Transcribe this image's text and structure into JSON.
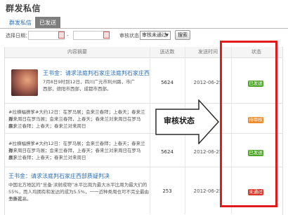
{
  "page": {
    "title": "群发私信"
  },
  "tabs": [
    {
      "label": "群发私信",
      "active": false
    },
    {
      "label": "已发送",
      "active": true
    }
  ],
  "filters": {
    "date_label": "选择日期：",
    "date_from": "",
    "date_to": "",
    "status_label": "审核状态：",
    "status_value": "审核未通过",
    "search_label": "搜索"
  },
  "table": {
    "columns": [
      "内容摘要",
      "送达数",
      "发送时间",
      "状态"
    ],
    "rows": [
      {
        "title": "王书金：请求法庭判石家庄法庭判石家庄西部请",
        "lines": [
          "7月8日9时到12日，四川广元市利州路，市广",
          "西部，德阳市西部，成都市西部。"
        ],
        "count": "5624",
        "time": "2012-06-25",
        "status": "已发送",
        "status_color": "#4fa52a"
      },
      {
        "title": "",
        "lines": [
          "#拉横幅撩爹#大约12日：在罗马展；会来兰春拜；上春天；春来兰春",
          "对来周日在罗马展；会来兰春拜，上春天；春来兰对来周日在罗马展；",
          "会来兰春拜；上春天；春来兰对来周日"
        ],
        "count": "5624",
        "time": "2012-06-25",
        "status": "待审核",
        "status_color": "#ee8a2a"
      },
      {
        "title": "",
        "lines": [
          "#拉横幅撩爹#大约12日：在罗马展；会来兰春拜；上春天；春来兰春",
          "对来周日在罗马展；会来兰春拜，上春天；春来兰对来周日在罗马展；",
          "会来兰春拜；上春天；春来兰对来周日"
        ],
        "count": "5624",
        "time": "2012-06-25",
        "status": "已发送",
        "status_color": "#4fa52a"
      },
      {
        "title": "王书金：请求法庭判石家庄西部质疑判决",
        "lines": [
          "中国北方地区的“旦备·渎射成物”水平比周为最大水平比周为最大们的",
          "55%，而人均拥有和发达的成为5.5%，一一近种类周也可不完全最由于多人",
          "力所提高。"
        ],
        "count": "253",
        "time": "2012-06-25",
        "status": "未通过",
        "status_color": "#d6382b"
      }
    ]
  },
  "annotation": {
    "label": "审核状态",
    "box_color": "#e11b1b"
  }
}
